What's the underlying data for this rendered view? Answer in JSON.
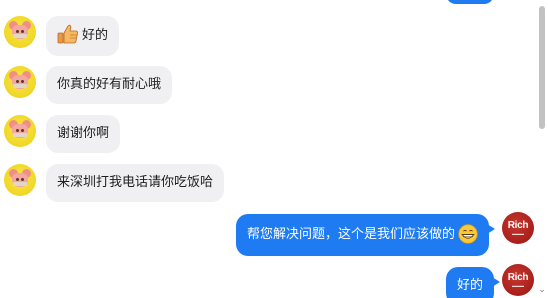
{
  "conversation": {
    "messages": [
      {
        "side": "left",
        "text": "好的",
        "emoji": "thumbs-up"
      },
      {
        "side": "left",
        "text": "你真的好有耐心哦"
      },
      {
        "side": "left",
        "text": "谢谢你啊"
      },
      {
        "side": "left",
        "text": "来深圳打我电话请你吃饭哈"
      },
      {
        "side": "right",
        "text": "帮您解决问题，这个是我们应该做的",
        "emoji": "grinning-face"
      },
      {
        "side": "right",
        "text": "好的"
      }
    ],
    "agent_avatar_text": "Rich",
    "colors": {
      "outgoing_bubble": "#1e7bf2",
      "incoming_bubble": "#f0f0f2",
      "agent_avatar": "#a81f1a",
      "customer_avatar": "#f2d92a"
    }
  },
  "scrollbar": {
    "down_arrow": "⌄"
  }
}
